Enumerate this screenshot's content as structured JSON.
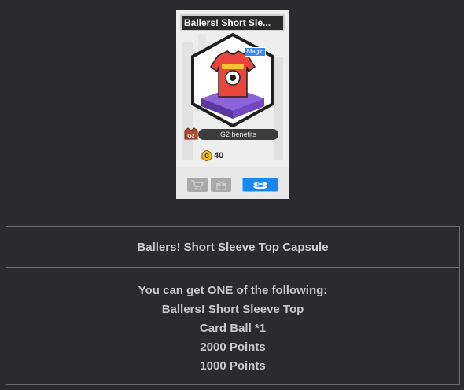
{
  "card": {
    "title": "Ballers! Short Sle...",
    "badge": "Magic",
    "g2_icon_label": "G2",
    "g2_label": "G2 benefits",
    "price": "40",
    "currency_icon": "coin-icon",
    "buttons": {
      "cart_icon": "cart-icon",
      "gift_icon": "gift-icon",
      "coupon_icon": "coupon-icon"
    },
    "colors": {
      "badge": "#3c86ee",
      "coupon_button": "#1688ee",
      "shirt": "#e8453c",
      "pedestal": "#7b52c7"
    }
  },
  "panel": {
    "title": "Ballers! Short Sleeve Top Capsule",
    "intro": "You can get ONE of the following:",
    "items": [
      "Ballers! Short Sleeve Top",
      "Card Ball *1",
      "2000 Points",
      "1000 Points"
    ]
  }
}
